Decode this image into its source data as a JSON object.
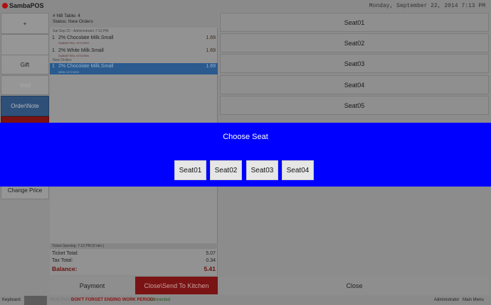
{
  "app": {
    "logo_text": "SambaPOS",
    "datetime": "Monday, September 22, 2014 7:13 PM"
  },
  "left_buttons": [
    {
      "label": "+"
    },
    {
      "label": ""
    },
    {
      "label": "Gift"
    },
    {
      "label": "Void"
    },
    {
      "label": "Order\\Note"
    },
    {
      "label": "Change Price"
    }
  ],
  "ticket": {
    "header_line1": "# NB Table: 4",
    "header_line2": "Status: New Orders",
    "sub_header": "Sat Sep 22 - Administrator 7:12 PM",
    "orders": [
      {
        "qty": "1",
        "name": "2% Chocolate Milk.Small",
        "price": "1.69",
        "tag": "SUBMITTED, KITCHEN"
      },
      {
        "qty": "1",
        "name": "2% White Milk.Small",
        "price": "1.69",
        "tag": "SUBMITTED, KITCHEN"
      },
      {
        "qty": "1",
        "name": "2% Chocolate Milk.Small",
        "price": "1.69",
        "tag": "NEW, KITCHEN"
      }
    ],
    "new_orders_label": "New Orders",
    "opening": "Ticket Opening:  7:12 PM (0 min.)",
    "ticket_total_label": "Ticket Total:",
    "ticket_total": "5.07",
    "tax_total_label": "Tax Total:",
    "tax_total": "0.34",
    "balance_label": "Balance:",
    "balance": "5.41"
  },
  "seats": [
    "Seat01",
    "Seat02",
    "Seat03",
    "Seat04",
    "Seat05"
  ],
  "bottom": {
    "payment": "Payment",
    "close_send": "Close\\Send To Kitchen",
    "close": "Close"
  },
  "statusbar": {
    "keyboard": "Keyboard",
    "workperiod": "Work Period",
    "warning": "DON'T FORGET ENDING WORK PERIOD!",
    "connected": "Connected",
    "user": "Administrator",
    "main_menu": "Main Menu"
  },
  "modal": {
    "title": "Choose Seat",
    "options": [
      "Seat01",
      "Seat02",
      "Seat03",
      "Seat04"
    ]
  },
  "colors": {
    "modal_bg": "#0000ff",
    "selected_order": "#2a5a8e",
    "close_send": "#7a1414",
    "balance": "#6a0e0e"
  }
}
